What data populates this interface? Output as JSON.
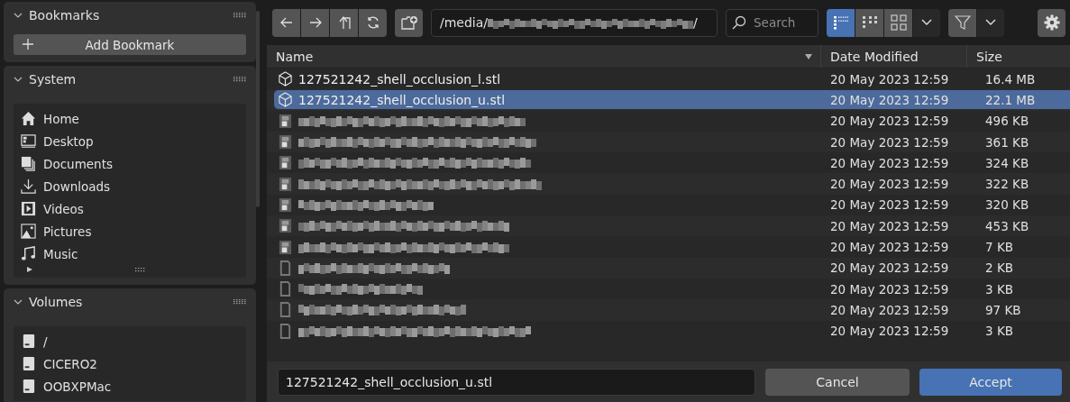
{
  "sidebar": {
    "panels": [
      {
        "title": "Bookmarks",
        "expanded": true,
        "kind": "button",
        "button": "Add Bookmark"
      },
      {
        "title": "System",
        "expanded": true,
        "kind": "places",
        "items": [
          {
            "label": "Home"
          },
          {
            "label": "Desktop"
          },
          {
            "label": "Documents"
          },
          {
            "label": "Downloads"
          },
          {
            "label": "Videos"
          },
          {
            "label": "Pictures"
          },
          {
            "label": "Music"
          }
        ]
      },
      {
        "title": "Volumes",
        "expanded": true,
        "kind": "volumes",
        "items": [
          {
            "label": "/"
          },
          {
            "label": "CICERO2"
          },
          {
            "label": "OOBXPMac"
          }
        ]
      }
    ]
  },
  "toolbar": {
    "path_start": "/media/",
    "path_end": "/",
    "search": {
      "placeholder": "Search"
    },
    "view_modes": [
      {
        "kind": "list",
        "selected": true
      },
      {
        "kind": "columns",
        "selected": false
      },
      {
        "kind": "grid",
        "selected": false
      }
    ]
  },
  "table": {
    "columns": [
      "Name",
      "Date Modified",
      "Size"
    ],
    "rows": [
      {
        "kind": "model",
        "name": "127521242_shell_occlusion_l.stl",
        "date": "20 May 2023 12:59",
        "size": "16.4 MB",
        "selected": false
      },
      {
        "kind": "model",
        "name": "127521242_shell_occlusion_u.stl",
        "date": "20 May 2023 12:59",
        "size": "22.1 MB",
        "selected": true
      },
      {
        "kind": "image",
        "date": "20 May 2023 12:59",
        "size": "496 KB",
        "selected": false
      },
      {
        "kind": "image",
        "date": "20 May 2023 12:59",
        "size": "361 KB",
        "selected": false
      },
      {
        "kind": "image",
        "date": "20 May 2023 12:59",
        "size": "324 KB",
        "selected": false
      },
      {
        "kind": "image",
        "date": "20 May 2023 12:59",
        "size": "322 KB",
        "selected": false
      },
      {
        "kind": "image",
        "date": "20 May 2023 12:59",
        "size": "320 KB",
        "selected": false
      },
      {
        "kind": "image",
        "date": "20 May 2023 12:59",
        "size": "453 KB",
        "selected": false
      },
      {
        "kind": "image",
        "date": "20 May 2023 12:59",
        "size": "7 KB",
        "selected": false
      },
      {
        "kind": "file",
        "date": "20 May 2023 12:59",
        "size": "2 KB",
        "selected": false
      },
      {
        "kind": "file",
        "date": "20 May 2023 12:59",
        "size": "3 KB",
        "selected": false
      },
      {
        "kind": "file",
        "date": "20 May 2023 12:59",
        "size": "97 KB",
        "selected": false
      },
      {
        "kind": "file",
        "date": "20 May 2023 12:59",
        "size": "3 KB",
        "selected": false
      }
    ]
  },
  "footer": {
    "filename": "127521242_shell_occlusion_u.stl",
    "buttons": [
      "Cancel",
      "Accept"
    ]
  }
}
